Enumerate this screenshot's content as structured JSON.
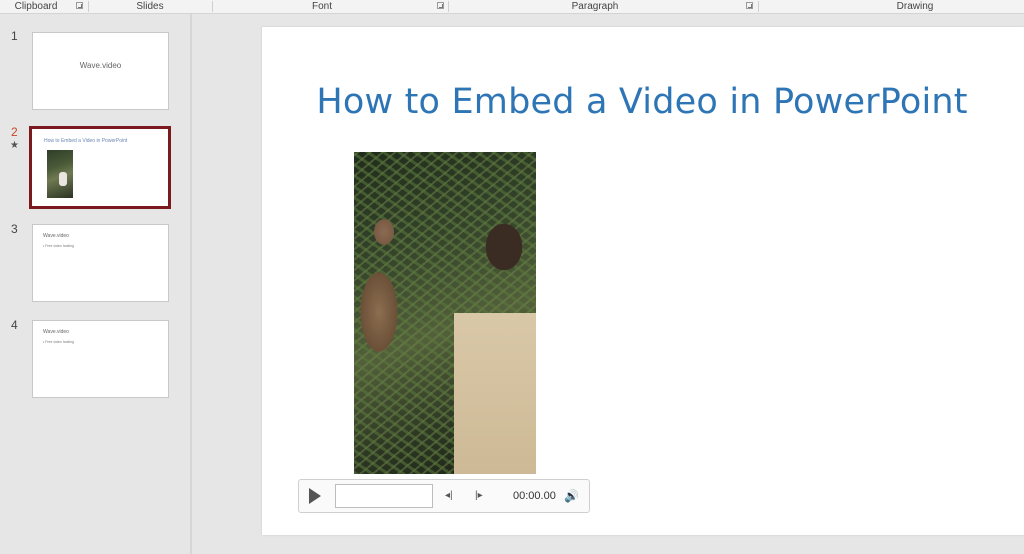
{
  "ribbon": {
    "groups": [
      "Clipboard",
      "Slides",
      "Font",
      "Paragraph",
      "Drawing"
    ]
  },
  "thumbnails": [
    {
      "number": "1",
      "title": "Wave.video",
      "bullet": ""
    },
    {
      "number": "2",
      "title": "How to Embed a Video in PowerPoint",
      "bullet": "",
      "has_animation_star": true,
      "star": "★",
      "selected": true
    },
    {
      "number": "3",
      "title": "Wave.video",
      "bullet": "• Free video hosting"
    },
    {
      "number": "4",
      "title": "Wave.video",
      "bullet": "• Free video hosting"
    }
  ],
  "slide": {
    "title": "How to Embed a Video in PowerPoint",
    "title_color": "#2e75b6"
  },
  "video_controls": {
    "time": "00:00.00",
    "icons": [
      "play-icon",
      "step-back-icon",
      "step-forward-icon",
      "volume-icon"
    ],
    "step_back": "◂|",
    "step_forward": "|▸",
    "volume": "🔊"
  },
  "colors": {
    "selected_border": "#7a1a1f",
    "active_number": "#c5472a"
  }
}
